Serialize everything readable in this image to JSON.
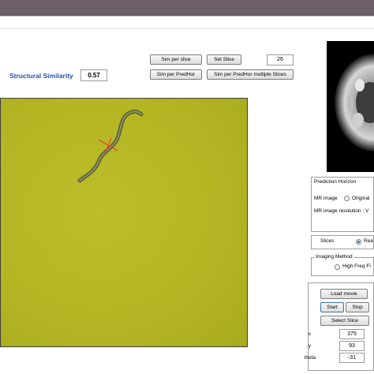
{
  "structural_similarity": {
    "label": "Structural Similarity",
    "value": "0.57"
  },
  "toolbar": {
    "sim_per_slice": "Sim per slice",
    "set_slice": "Set Slice",
    "slice_number": "26",
    "sim_per_predhor": "Sim per PredHor",
    "sim_per_predhor_multi": "Sim per PredHor multiple Slices"
  },
  "prediction_horizon": {
    "title": "Prediction Horizon",
    "mr_image_label": "MR image",
    "mr_image_option": "Original",
    "resolution_label": "MR image resolution : V"
  },
  "slices": {
    "label": "Slices",
    "option": "Rea"
  },
  "imaging_method": {
    "title": "Imaging Method",
    "option": "High Freq Fi"
  },
  "controls": {
    "load_movie": "Load movie",
    "start": "Start",
    "stop": "Stop",
    "select_slice": "Select Slice"
  },
  "coords": {
    "x_label": "x",
    "x_value": "375",
    "y_label": "y",
    "y_value": "93",
    "theta_label": "theta",
    "theta_value": "-31"
  },
  "colors": {
    "title_bar": "#6d5f6a",
    "accent_text": "#2a54a6",
    "video_background": "#b4b624",
    "worm_body": "#5a5f3a",
    "cross_marker": "#e0452a"
  }
}
